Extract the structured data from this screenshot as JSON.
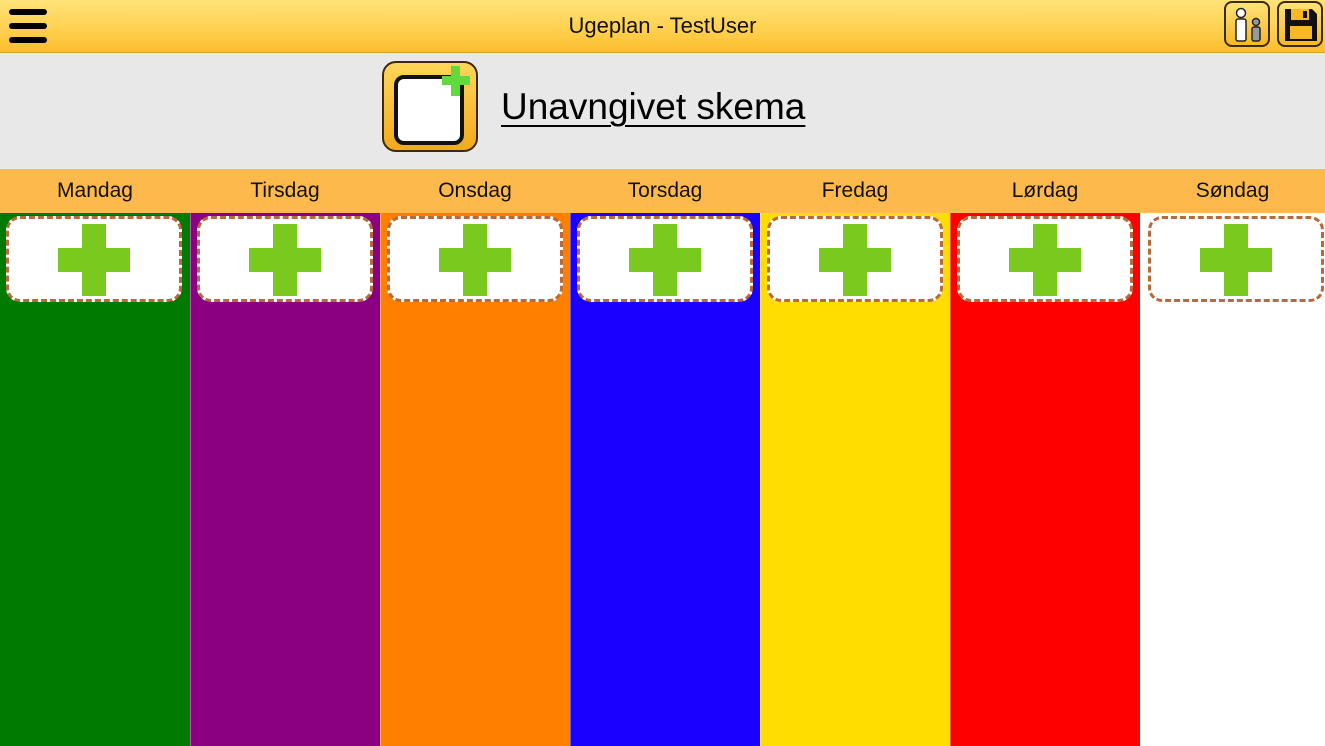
{
  "app": {
    "title": "Ugeplan - TestUser",
    "menu_icon": "hamburger-menu-icon",
    "users_icon": "users-icon",
    "save_icon": "save-floppy-icon"
  },
  "schedule": {
    "title": "Unavngivet skema",
    "new_icon": "new-schedule-icon"
  },
  "colors": {
    "topbar": "#ffd150",
    "header_bg": "#e8e8e8",
    "day_header_bg": "#fdb94c",
    "add_plus": "#7ac91f",
    "card_border": "#b86a3a"
  },
  "days": [
    {
      "label": "Mandag",
      "color": "#007a00"
    },
    {
      "label": "Tirsdag",
      "color": "#8a0080"
    },
    {
      "label": "Onsdag",
      "color": "#ff7f00"
    },
    {
      "label": "Torsdag",
      "color": "#1a00ff"
    },
    {
      "label": "Fredag",
      "color": "#ffdd00"
    },
    {
      "label": "Lørdag",
      "color": "#ff0000"
    },
    {
      "label": "Søndag",
      "color": "#ffffff"
    }
  ],
  "add_activity_icon": "plus-icon"
}
